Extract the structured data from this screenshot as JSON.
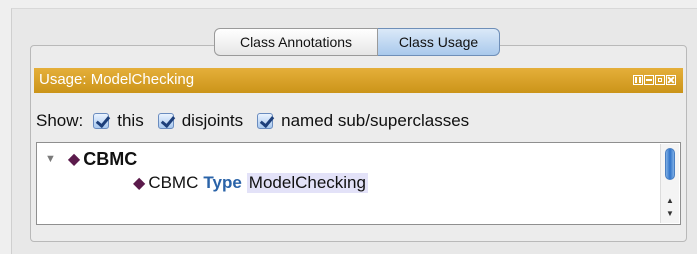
{
  "tabs": [
    {
      "label": "Class Annotations",
      "selected": false
    },
    {
      "label": "Class Usage",
      "selected": true
    }
  ],
  "panel": {
    "title": "Usage: ModelChecking",
    "header_color": "#d9a12a",
    "header_buttons": [
      "split-icon",
      "minimize-icon",
      "restore-icon",
      "close-icon"
    ]
  },
  "show": {
    "label": "Show:",
    "options": [
      {
        "label": "this",
        "checked": true
      },
      {
        "label": "disjoints",
        "checked": true
      },
      {
        "label": "named sub/superclasses",
        "checked": true
      }
    ]
  },
  "tree": {
    "root": {
      "icon": "class-diamond-icon",
      "label": "CBMC",
      "expanded": true
    },
    "child": {
      "icon": "class-diamond-icon",
      "subject": "CBMC",
      "keyword": "Type",
      "object": "ModelChecking"
    }
  }
}
